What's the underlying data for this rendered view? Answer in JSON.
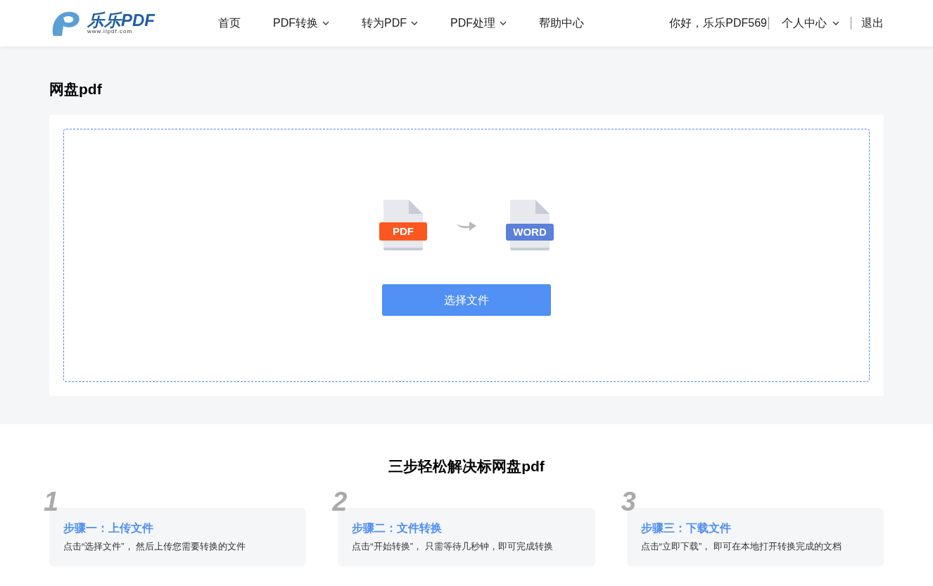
{
  "header": {
    "logo": {
      "brand": "乐乐PDF",
      "url": "www.llpdf.com"
    },
    "nav": [
      {
        "label": "首页",
        "has_caret": false
      },
      {
        "label": "PDF转换",
        "has_caret": true
      },
      {
        "label": "转为PDF",
        "has_caret": true
      },
      {
        "label": "PDF处理",
        "has_caret": true
      },
      {
        "label": "帮助中心",
        "has_caret": false
      }
    ],
    "user": {
      "greeting": "你好，乐乐PDF569",
      "account": "个人中心",
      "logout": "退出"
    }
  },
  "page_title": "网盘pdf",
  "upload": {
    "from_label": "PDF",
    "to_label": "WORD",
    "button": "选择文件"
  },
  "steps_title": "三步轻松解决标网盘pdf",
  "steps": [
    {
      "number": "1",
      "title": "步骤一：上传文件",
      "text": "点击“选择文件”， 然后上传您需要转换的文件"
    },
    {
      "number": "2",
      "title": "步骤二：文件转换",
      "text": "点击“开始转换”， 只需等待几秒钟，即可完成转换"
    },
    {
      "number": "3",
      "title": "步骤三：下载文件",
      "text": "点击“立即下载”， 即可在本地打开转换完成的文档"
    }
  ]
}
